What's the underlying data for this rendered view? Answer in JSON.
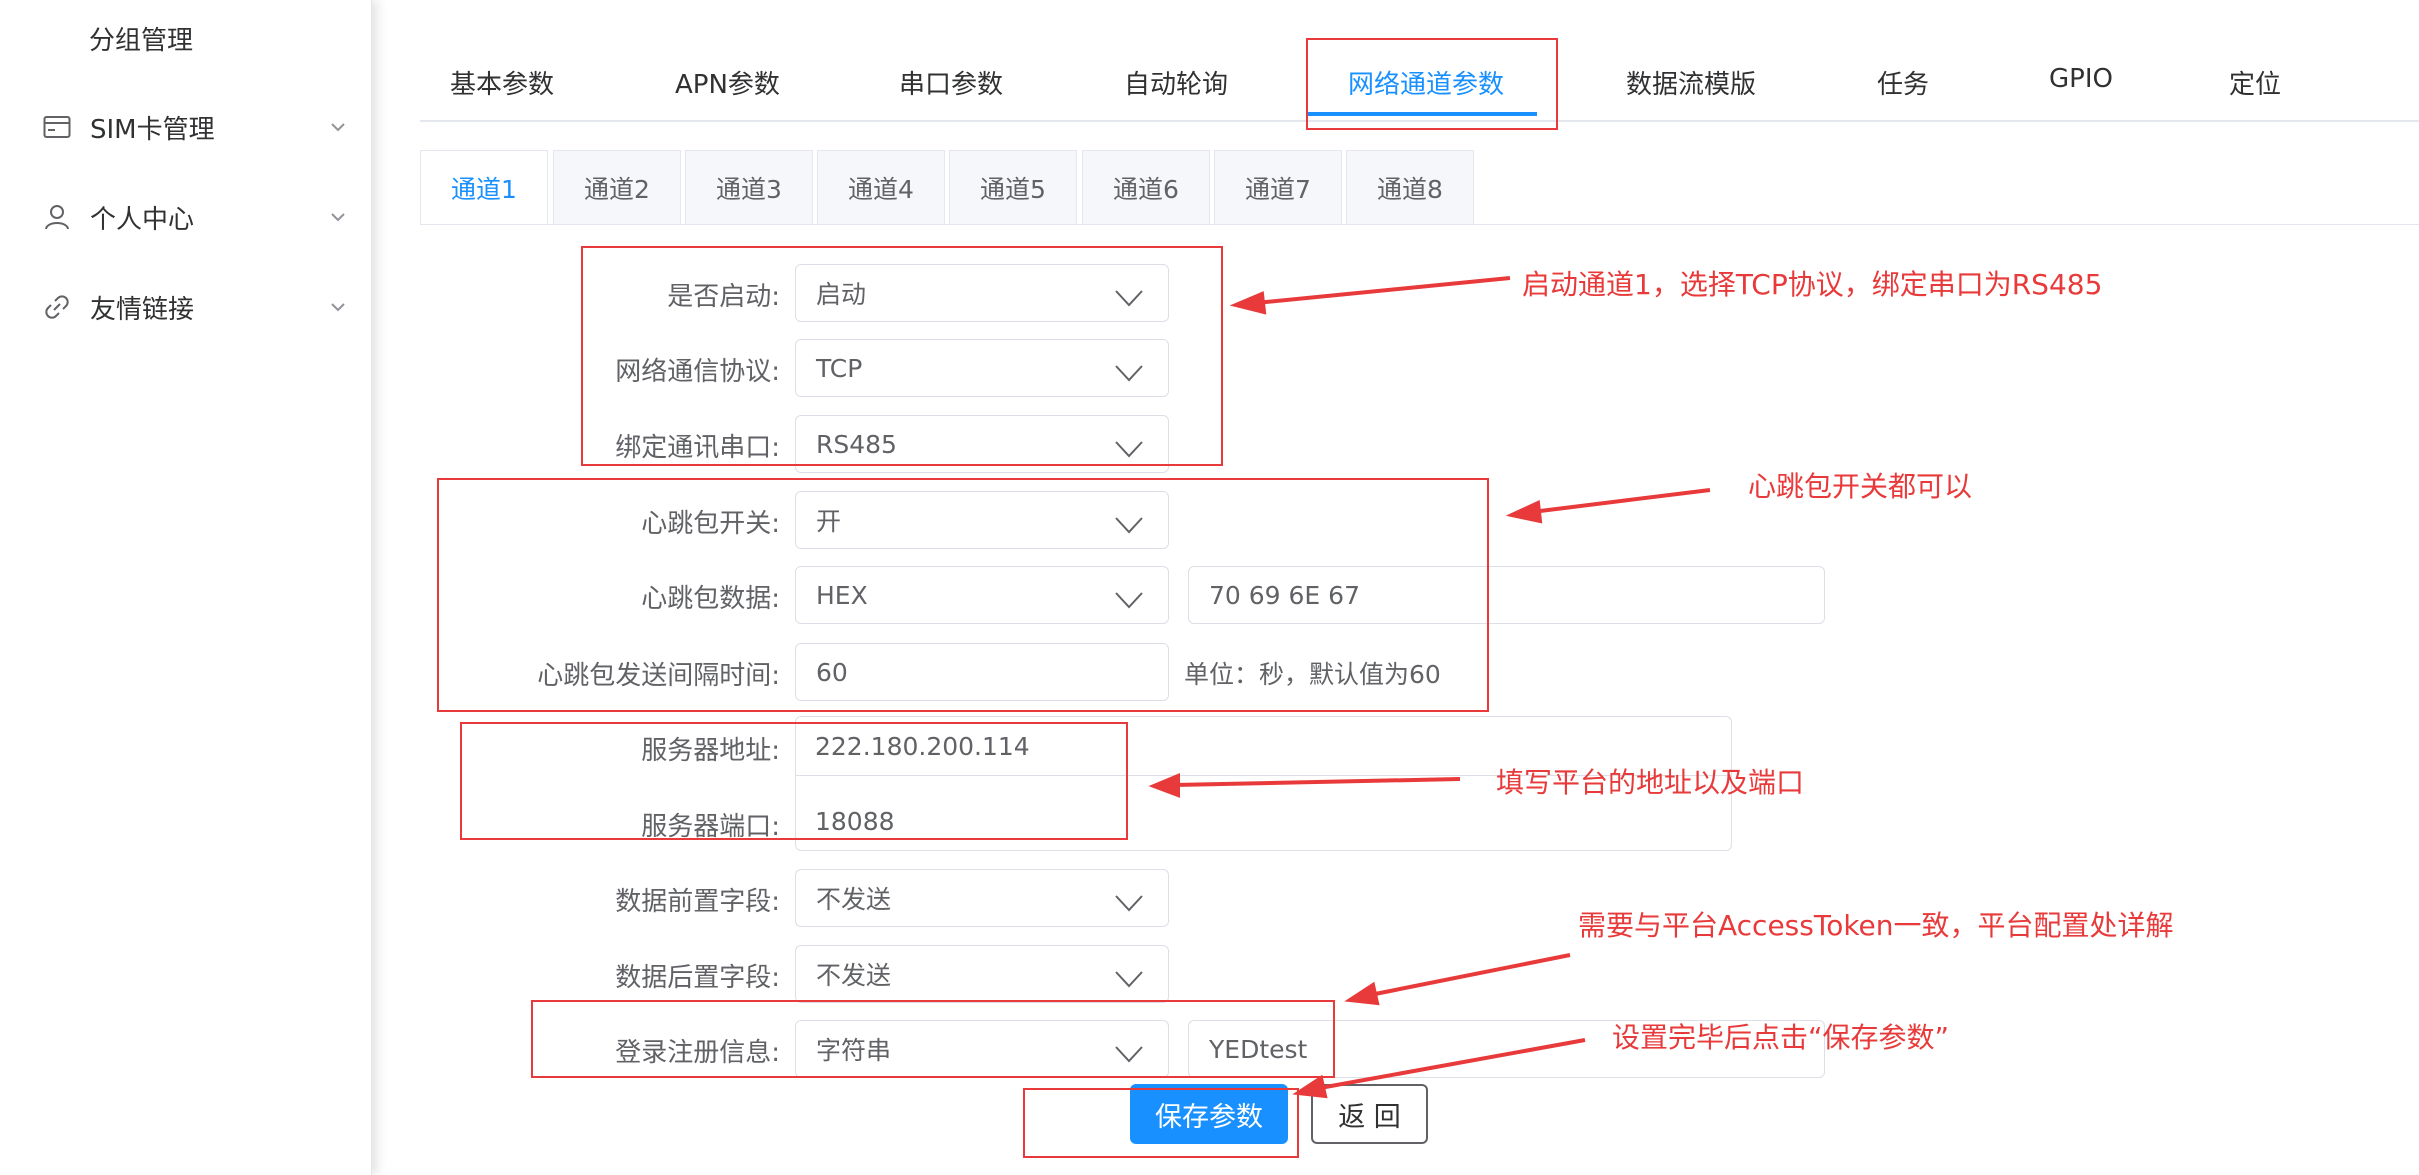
{
  "sidebar": {
    "group_label": "分组管理",
    "items": [
      {
        "label": "SIM卡管理",
        "icon": "card-icon"
      },
      {
        "label": "个人中心",
        "icon": "user-icon"
      },
      {
        "label": "友情链接",
        "icon": "link-icon"
      }
    ]
  },
  "top_tabs": [
    "基本参数",
    "APN参数",
    "串口参数",
    "自动轮询",
    "网络通道参数",
    "数据流模版",
    "任务",
    "GPIO",
    "定位"
  ],
  "top_tabs_active": "网络通道参数",
  "channel_tabs": [
    "通道1",
    "通道2",
    "通道3",
    "通道4",
    "通道5",
    "通道6",
    "通道7",
    "通道8"
  ],
  "channel_tabs_active": "通道1",
  "form": {
    "enable": {
      "label": "是否启动:",
      "value": "启动"
    },
    "protocol": {
      "label": "网络通信协议:",
      "value": "TCP"
    },
    "serial": {
      "label": "绑定通讯串口:",
      "value": "RS485"
    },
    "heartbeat_switch": {
      "label": "心跳包开关:",
      "value": "开"
    },
    "heartbeat_data": {
      "label": "心跳包数据:",
      "type_value": "HEX",
      "data_value": "70 69 6E 67"
    },
    "heartbeat_interval": {
      "label": "心跳包发送间隔时间:",
      "value": "60",
      "unit_text": "单位：秒，默认值为60"
    },
    "server_address": {
      "label": "服务器地址:",
      "value": "222.180.200.114"
    },
    "server_port": {
      "label": "服务器端口:",
      "value": "18088"
    },
    "prefix": {
      "label": "数据前置字段:",
      "value": "不发送"
    },
    "suffix": {
      "label": "数据后置字段:",
      "value": "不发送"
    },
    "login_info": {
      "label": "登录注册信息:",
      "type_value": "字符串",
      "data_value": "YEDtest"
    }
  },
  "buttons": {
    "save": "保存参数",
    "back": "返 回"
  },
  "annotations": {
    "note1": "启动通道1，选择TCP协议，绑定串口为RS485",
    "note2": "心跳包开关都可以",
    "note3": "填写平台的地址以及端口",
    "note4": "需要与平台AccessToken一致，平台配置处详解",
    "note5": "设置完毕后点击“保存参数”"
  },
  "colors": {
    "accent": "#1890ff",
    "annotation": "#e83a3a"
  }
}
